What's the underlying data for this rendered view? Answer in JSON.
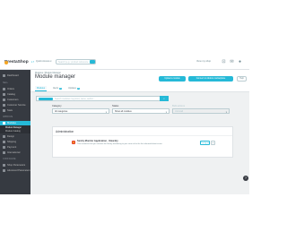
{
  "header": {
    "logo_text": "PrestaShop",
    "logo_version": "1.7",
    "quick_access": "Quick Access ▾",
    "search_placeholder": "Search (e.g.: product reference, custome",
    "view_my_shop": "View my shop",
    "icons": [
      "cart-icon",
      "mail-icon",
      "user-icon"
    ]
  },
  "sidebar": {
    "top_item": "Dashboard",
    "sell_title": "SELL",
    "sell_items": [
      "Orders",
      "Catalog",
      "Customers",
      "Customer Service",
      "Stats"
    ],
    "improve_title": "IMPROVE",
    "modules_label": "Modules",
    "module_subitems": [
      "Module Manager",
      "Module Catalog"
    ],
    "improve_items": [
      "Design",
      "Shipping",
      "Payment",
      "International"
    ],
    "configure_title": "CONFIGURE",
    "configure_items": [
      "Shop Parameters",
      "Advanced Parameters"
    ]
  },
  "toolbar": {
    "breadcrumb": "Modules / Module Manager",
    "title": "Module manager",
    "upload_label": "Upload a module",
    "connect_label": "Connect to Addons marketplace",
    "help_label": "Help",
    "tabs": [
      {
        "label": "Modules",
        "badge": ""
      },
      {
        "label": "Alerts",
        "badge": "1"
      },
      {
        "label": "Updates",
        "badge": "1"
      }
    ]
  },
  "filters": {
    "search_placeholder": "Search modules: keyword, name, author...",
    "category_label": "Category",
    "category_value": "All categories",
    "status_label": "Status",
    "status_value": "Show all modules",
    "bulk_label": "Bulk actions",
    "bulk_value": "Uninstall"
  },
  "module_section": {
    "title": "Administration",
    "module": {
      "name": "Sentry Monitor Application - Sixardry",
      "description": "This connector lets you connect the Sentry monitoring to your store to be the first informed about errors",
      "configure_label": "Configure",
      "dropdown_icon": "chevron-down-icon"
    }
  },
  "colors": {
    "accent": "#25b9d7",
    "sidebar_bg": "#363a41",
    "page_bg": "#eff1f2"
  }
}
